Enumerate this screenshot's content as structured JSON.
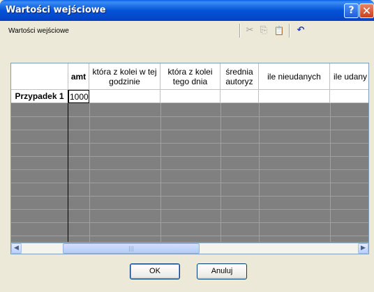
{
  "window": {
    "title": "Wartości wejściowe"
  },
  "titlebar": {
    "help_glyph": "?",
    "close_glyph": "✕"
  },
  "subheader": {
    "label": "Wartości wejściowe"
  },
  "toolbar": {
    "icons": [
      "scissors-icon",
      "copy-icon",
      "paste-icon",
      "undo-icon"
    ],
    "cut_glyph": "✂",
    "copy_glyph": "⎘",
    "paste_glyph": "📋",
    "undo_glyph": "↶"
  },
  "grid": {
    "columns": [
      "amt",
      "która z kolei w tej godzinie",
      "która z kolei tego dnia",
      "średnia autoryz",
      "ile nieudanych",
      "ile udany"
    ],
    "rows": [
      {
        "label": "Przypadek 1",
        "values": [
          "1000",
          "",
          "",
          "",
          "",
          ""
        ]
      }
    ]
  },
  "scrollbar": {
    "left_glyph": "◀",
    "right_glyph": "▶",
    "thumb_grip": "|||"
  },
  "buttons": {
    "ok": "OK",
    "cancel": "Anuluj"
  },
  "colors": {
    "title_bar": "#0553D8",
    "grid_empty": "#808080",
    "dialog_bg": "#ECE9D8"
  }
}
